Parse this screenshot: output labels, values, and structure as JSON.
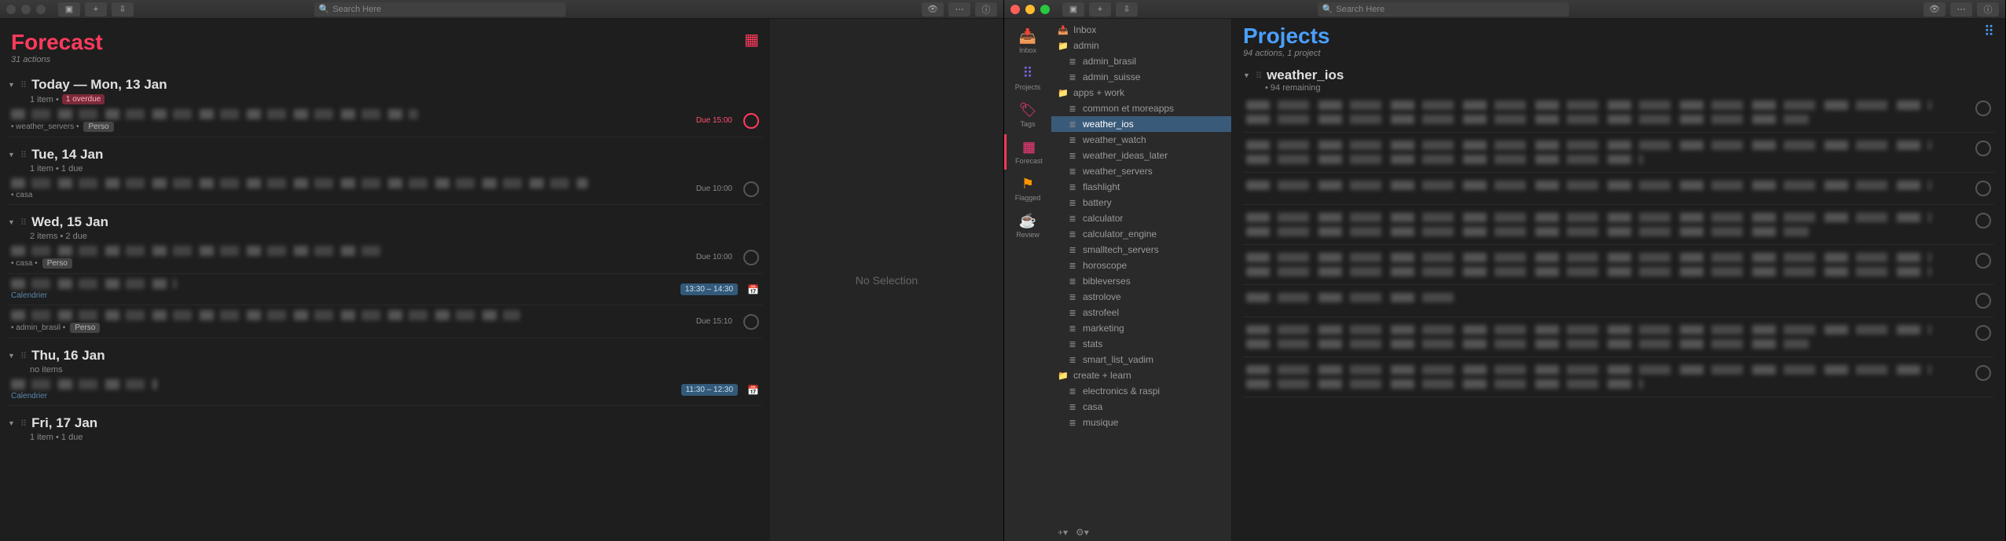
{
  "left_window": {
    "search_placeholder": "Search Here",
    "title": "Forecast",
    "subtitle": "31 actions",
    "no_selection": "No Selection",
    "days": [
      {
        "title": "Today — Mon, 13 Jan",
        "sub_prefix": "1 item •",
        "badge": "1 overdue",
        "tasks": [
          {
            "meta_project": "• weather_servers •",
            "tag": "Perso",
            "due_label": "Due",
            "due_time": "15:00",
            "overdue": true
          }
        ]
      },
      {
        "title": "Tue, 14 Jan",
        "sub": "1 item • 1 due",
        "tasks": [
          {
            "meta_project": "• casa",
            "due_label": "Due",
            "due_time": "10:00"
          }
        ]
      },
      {
        "title": "Wed, 15 Jan",
        "sub": "2 items • 2 due",
        "tasks": [
          {
            "meta_project": "• casa •",
            "tag": "Perso",
            "due_label": "Due",
            "due_time": "10:00"
          },
          {
            "calendar": true,
            "cal_label": "Calendrier",
            "time_range": "13:30 – 14:30"
          },
          {
            "meta_project": "• admin_brasil •",
            "tag": "Perso",
            "due_label": "Due",
            "due_time": "15:10"
          }
        ]
      },
      {
        "title": "Thu, 16 Jan",
        "sub": "no items",
        "tasks": [
          {
            "calendar": true,
            "cal_label": "Calendrier",
            "time_range": "11:30 – 12:30"
          }
        ]
      },
      {
        "title": "Fri, 17 Jan",
        "sub": "1 item • 1 due",
        "tasks": []
      }
    ]
  },
  "right_window": {
    "search_placeholder": "Search Here",
    "nav": [
      {
        "label": "Inbox",
        "icon": "📥"
      },
      {
        "label": "Projects",
        "icon": "⠿"
      },
      {
        "label": "Tags",
        "icon": "🏷"
      },
      {
        "label": "Forecast",
        "icon": "▦",
        "active": true
      },
      {
        "label": "Flagged",
        "icon": "⚑"
      },
      {
        "label": "Review",
        "icon": "☕"
      }
    ],
    "tree": {
      "inbox": "Inbox",
      "folders": [
        {
          "name": "admin",
          "items": [
            "admin_brasil",
            "admin_suisse"
          ]
        },
        {
          "name": "apps + work",
          "items": [
            "common et moreapps",
            "weather_ios",
            "weather_watch",
            "weather_ideas_later",
            "weather_servers",
            "flashlight",
            "battery",
            "calculator",
            "calculator_engine",
            "smalltech_servers",
            "horoscope",
            "bibleverses",
            "astrolove",
            "astrofeel",
            "marketing",
            "stats",
            "smart_list_vadim"
          ]
        },
        {
          "name": "create + learn",
          "items": [
            "electronics & raspi",
            "casa",
            "musique"
          ]
        }
      ],
      "selected": "weather_ios"
    },
    "title": "Projects",
    "subtitle": "94 actions, 1 project",
    "project_name": "weather_ios",
    "project_sub": "• 94 remaining"
  }
}
